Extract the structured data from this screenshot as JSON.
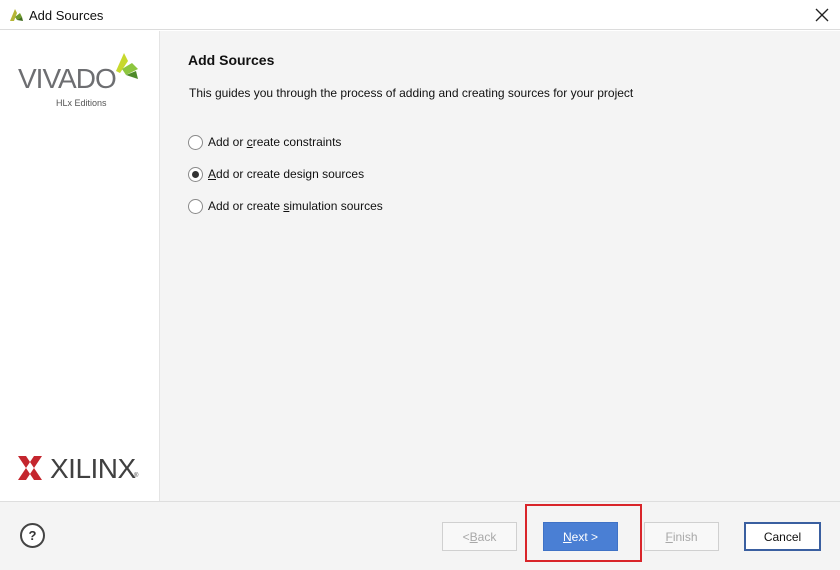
{
  "window": {
    "title": "Add Sources",
    "close_icon": "close-icon"
  },
  "sidebar": {
    "vivado_logo_text": "VIVADO",
    "vivado_logo_sub": "HLx Editions",
    "xilinx_logo_text": "XILINX",
    "xilinx_logo_reg": "®"
  },
  "page": {
    "heading": "Add Sources",
    "description": "This guides you through the process of adding and creating sources for your project",
    "options": [
      {
        "prefix": "Add or ",
        "mnemonic": "c",
        "suffix": "reate constraints",
        "checked": false
      },
      {
        "prefix": "",
        "mnemonic": "A",
        "suffix": "dd or create design sources",
        "checked": true
      },
      {
        "prefix": "Add or create ",
        "mnemonic": "s",
        "suffix": "imulation sources",
        "checked": false
      }
    ]
  },
  "footer": {
    "help_label": "?",
    "back": {
      "prefix": "< ",
      "mnemonic": "B",
      "suffix": "ack",
      "enabled": false
    },
    "next": {
      "prefix": "",
      "mnemonic": "N",
      "suffix": "ext >",
      "enabled": true
    },
    "finish": {
      "prefix": "",
      "mnemonic": "F",
      "suffix": "inish",
      "enabled": false
    },
    "cancel_label": "Cancel"
  },
  "colors": {
    "accent": "#4a7fd4",
    "highlight": "#d9252a",
    "vivado_green": "#8dc63f",
    "xilinx_red": "#c4262e"
  }
}
